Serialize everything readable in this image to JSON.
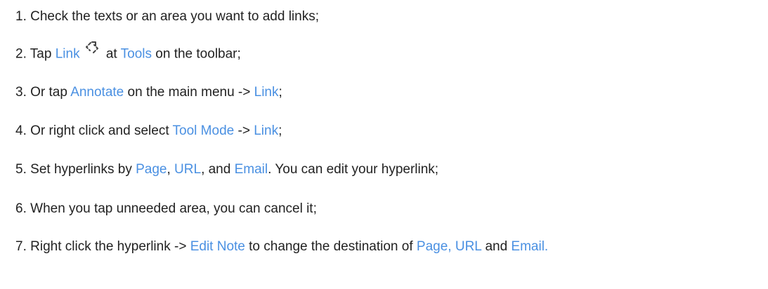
{
  "accent_color": "#4a90e2",
  "text_color": "#222222",
  "steps": [
    {
      "num": "1.",
      "parts": [
        "Check the texts or an area you want to add links;"
      ]
    },
    {
      "num": "2.",
      "parts": [
        "Tap",
        "Link",
        "at",
        "Tools",
        "on the toolbar;"
      ],
      "icon": "link-icon"
    },
    {
      "num": "3.",
      "parts": [
        "Or tap",
        "Annotate",
        "on the main menu ->",
        "Link",
        ";"
      ]
    },
    {
      "num": "4.",
      "parts": [
        "Or right click and select",
        "Tool Mode",
        "->",
        "Link",
        ";"
      ]
    },
    {
      "num": "5.",
      "parts": [
        "Set hyperlinks by",
        "Page",
        ",",
        "URL",
        ", and",
        "Email",
        ". You can edit your hyperlink;"
      ]
    },
    {
      "num": "6.",
      "parts": [
        "When you tap unneeded area, you can cancel it;"
      ]
    },
    {
      "num": "7.",
      "parts": [
        "Right click the hyperlink ->",
        "Edit Note",
        "to change the destination of",
        "Page,",
        "URL",
        "and",
        "Email."
      ]
    }
  ]
}
